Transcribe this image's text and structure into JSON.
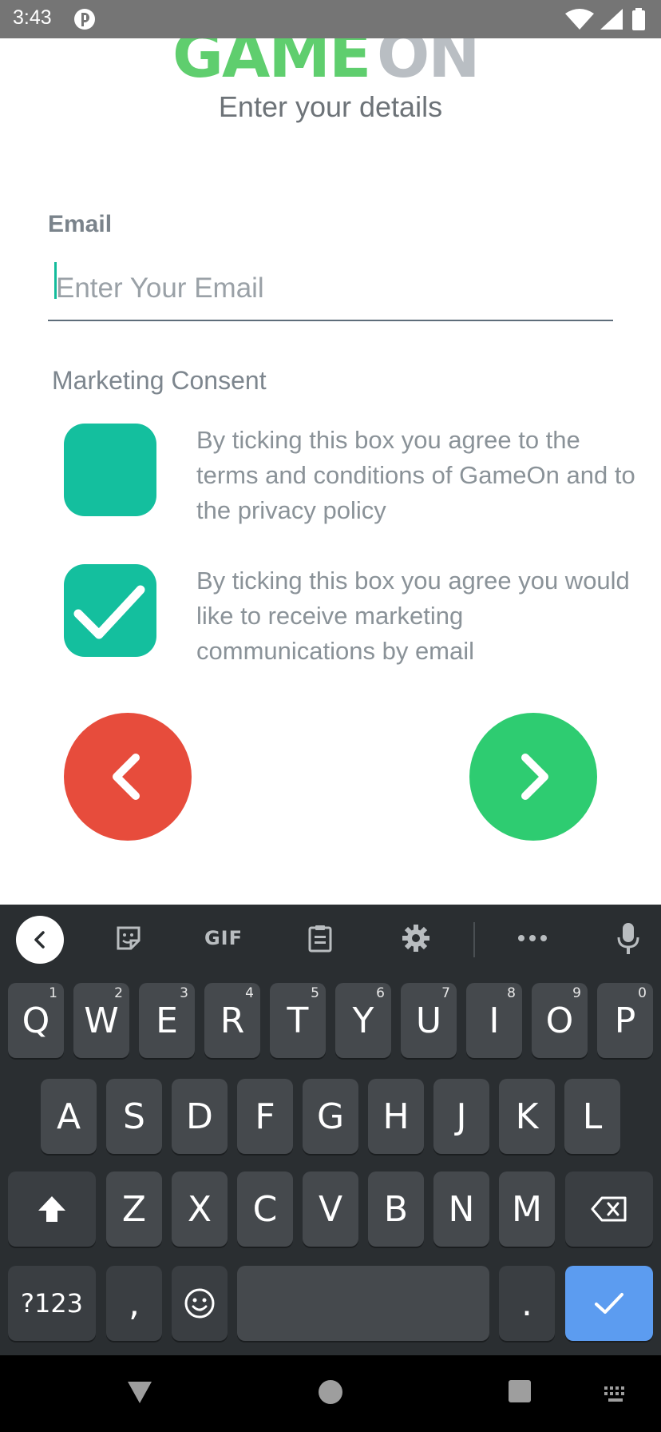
{
  "status_bar": {
    "time": "3:43",
    "icons": [
      "app-notification-icon",
      "wifi-icon",
      "signal-icon",
      "battery-icon"
    ]
  },
  "logo": {
    "text": "GAMEON",
    "color_game": "#5fce6e",
    "color_on": "#b9bec3"
  },
  "page": {
    "subtitle": "Enter your details"
  },
  "email": {
    "label": "Email",
    "placeholder": "Enter Your Email",
    "value": ""
  },
  "consent": {
    "heading": "Marketing Consent",
    "items": [
      {
        "text": "By ticking this box you agree to the terms and conditions of GameOn and to the privacy policy",
        "checked": false
      },
      {
        "text": "By ticking this box you agree you would like to receive marketing communications by email",
        "checked": true
      }
    ]
  },
  "nav_buttons": {
    "back_icon": "chevron-left-icon",
    "next_icon": "chevron-right-icon",
    "back_color": "#e74c3c",
    "next_color": "#2ecc71"
  },
  "keyboard": {
    "toolbar": {
      "gif_label": "GIF",
      "icons": [
        "back-arrow-icon",
        "sticker-icon",
        "gif-icon",
        "clipboard-icon",
        "settings-icon",
        "more-icon",
        "microphone-icon"
      ]
    },
    "row1": [
      {
        "label": "Q",
        "hint": "1"
      },
      {
        "label": "W",
        "hint": "2"
      },
      {
        "label": "E",
        "hint": "3"
      },
      {
        "label": "R",
        "hint": "4"
      },
      {
        "label": "T",
        "hint": "5"
      },
      {
        "label": "Y",
        "hint": "6"
      },
      {
        "label": "U",
        "hint": "7"
      },
      {
        "label": "I",
        "hint": "8"
      },
      {
        "label": "O",
        "hint": "9"
      },
      {
        "label": "P",
        "hint": "0"
      }
    ],
    "row2": [
      "A",
      "S",
      "D",
      "F",
      "G",
      "H",
      "J",
      "K",
      "L"
    ],
    "row3": [
      "Z",
      "X",
      "C",
      "V",
      "B",
      "N",
      "M"
    ],
    "row4": {
      "symbols": "?123",
      "comma": ",",
      "period": "."
    },
    "enter_color": "#5c9cf0"
  },
  "navbar": {
    "icons": [
      "back-triangle-icon",
      "home-circle-icon",
      "recents-square-icon",
      "keyboard-switch-icon"
    ]
  }
}
